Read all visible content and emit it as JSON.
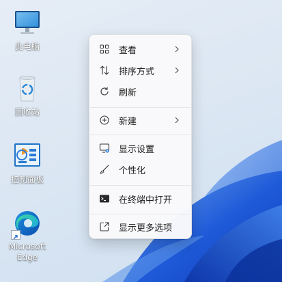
{
  "desktop": {
    "icons": [
      {
        "label": "此电脑",
        "icon": "computer-icon"
      },
      {
        "label": "回收站",
        "icon": "recycle-bin-icon"
      },
      {
        "label": "控制面板",
        "icon": "control-panel-icon"
      },
      {
        "label": "Microsoft\nEdge",
        "icon": "edge-icon"
      }
    ]
  },
  "context_menu": {
    "items": [
      {
        "label": "查看",
        "icon": "grid-icon",
        "has_submenu": true
      },
      {
        "label": "排序方式",
        "icon": "sort-icon",
        "has_submenu": true
      },
      {
        "label": "刷新",
        "icon": "refresh-icon",
        "has_submenu": false
      },
      {
        "label": "新建",
        "icon": "add-circle-icon",
        "has_submenu": true
      },
      {
        "label": "显示设置",
        "icon": "display-settings-icon",
        "has_submenu": false
      },
      {
        "label": "个性化",
        "icon": "brush-icon",
        "has_submenu": false
      },
      {
        "label": "在终端中打开",
        "icon": "terminal-icon",
        "has_submenu": false
      },
      {
        "label": "显示更多选项",
        "icon": "share-external-icon",
        "has_submenu": false
      }
    ]
  },
  "colors": {
    "wallpaper_blue": "#1f56d6",
    "menu_background": "#f9f9fb",
    "accent_blue": "#2b7bd6"
  }
}
